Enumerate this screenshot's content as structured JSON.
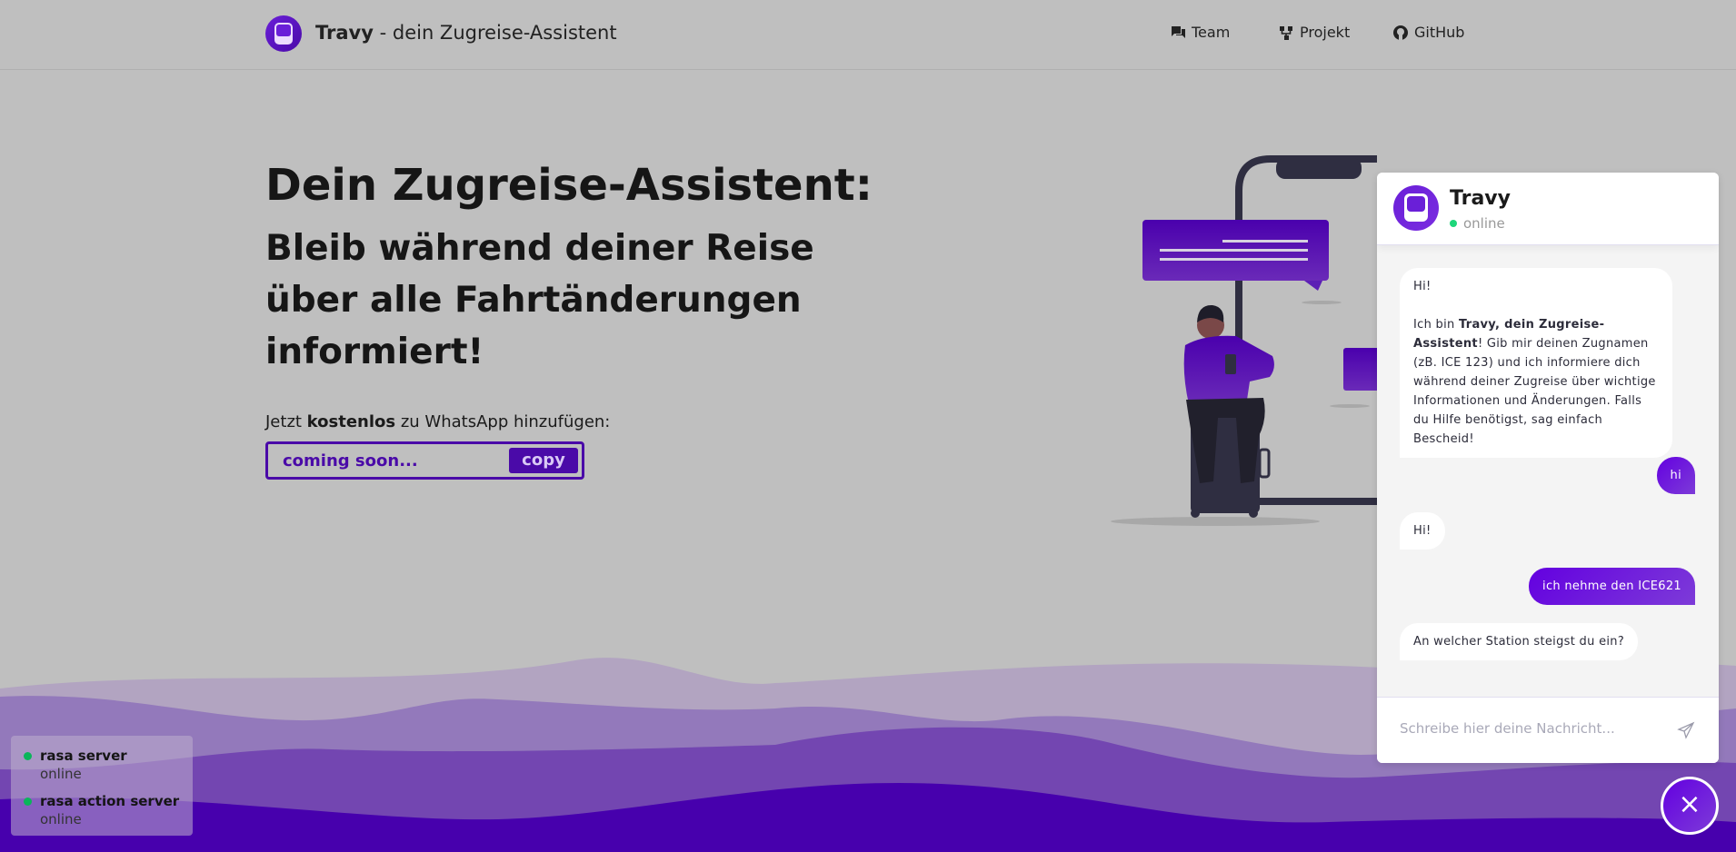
{
  "header": {
    "brand_name": "Travy",
    "brand_suffix": " - dein Zugreise-Assistent",
    "nav": [
      {
        "label": "Team",
        "icon": "chat-icon"
      },
      {
        "label": "Projekt",
        "icon": "git-branch-icon"
      },
      {
        "label": "GitHub",
        "icon": "github-icon"
      }
    ]
  },
  "hero": {
    "title": "Dein Zugreise-Assistent:",
    "subtitle": "Bleib während deiner Reise über alle Fahrtänderungen informiert!",
    "cta_prefix": "Jetzt ",
    "cta_bold": "kostenlos",
    "cta_suffix": " zu WhatsApp hinzufügen:",
    "number_value": "coming soon...",
    "copy_label": "copy"
  },
  "status": [
    {
      "name": "rasa server",
      "state": "online"
    },
    {
      "name": "rasa action server",
      "state": "online"
    }
  ],
  "chat": {
    "title": "Travy",
    "status": "online",
    "messages": [
      {
        "from": "bot",
        "line1": "Hi!",
        "pre": "Ich bin ",
        "bold": "Travy, dein Zugreise-Assistent",
        "post": "! Gib mir deinen Zugnamen (zB. ICE 123) und ich informiere dich während deiner Zugreise über wichtige Informationen und Änderungen. Falls du Hilfe benötigst, sag einfach Bescheid!"
      },
      {
        "from": "user",
        "text": "hi"
      },
      {
        "from": "bot",
        "text": "Hi!"
      },
      {
        "from": "user",
        "text": "ich nehme den ICE621"
      },
      {
        "from": "bot",
        "text": "An welcher Station steigst du ein?"
      }
    ],
    "input_placeholder": "Schreibe hier deine Nachricht...",
    "close_label": "×"
  },
  "colors": {
    "accent": "#4a0aa8",
    "user_bubble": "#6300e0",
    "online": "#1ed67a"
  }
}
